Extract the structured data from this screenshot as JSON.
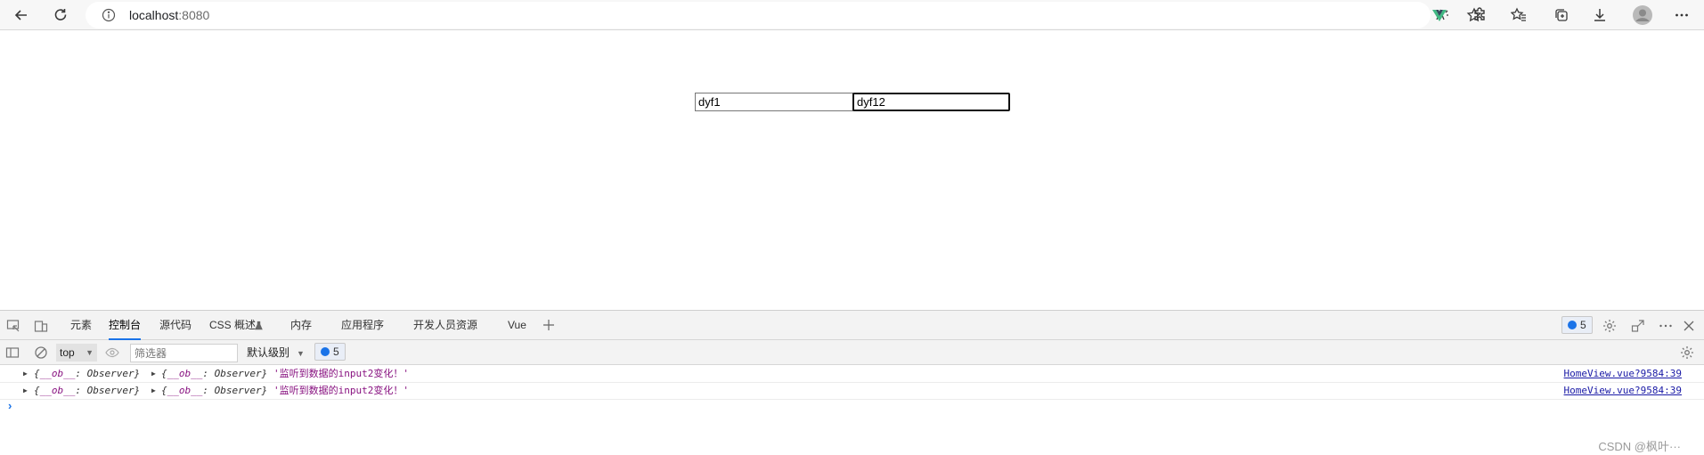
{
  "browser": {
    "url_host": "localhost",
    "url_port": ":8080"
  },
  "page": {
    "input1_value": "dyf1",
    "input2_value": "dyf12"
  },
  "devtools": {
    "tabs": [
      {
        "label": "元素"
      },
      {
        "label": "控制台"
      },
      {
        "label": "源代码"
      },
      {
        "label": "CSS 概述"
      },
      {
        "label": "内存"
      },
      {
        "label": "应用程序"
      },
      {
        "label": "开发人员资源"
      },
      {
        "label": "Vue"
      }
    ],
    "message_count": "5",
    "console": {
      "context": "top",
      "filter_placeholder": "筛选器",
      "level": "默认级别",
      "issue_count": "5"
    },
    "logs": [
      {
        "obj1_key": "__ob__",
        "obj1_val": "Observer",
        "obj2_key": "__ob__",
        "obj2_val": "Observer",
        "message": "'监听到数据的input2变化！'",
        "source": "HomeView.vue?9584:39"
      },
      {
        "obj1_key": "__ob__",
        "obj1_val": "Observer",
        "obj2_key": "__ob__",
        "obj2_val": "Observer",
        "message": "'监听到数据的input2变化！'",
        "source": "HomeView.vue?9584:39"
      }
    ]
  },
  "watermark": "CSDN @枫叶···",
  "colors": {
    "accent": "#1a73e8",
    "vue_green": "#41b883",
    "console_string": "#881280",
    "link": "#1a1aa6"
  }
}
